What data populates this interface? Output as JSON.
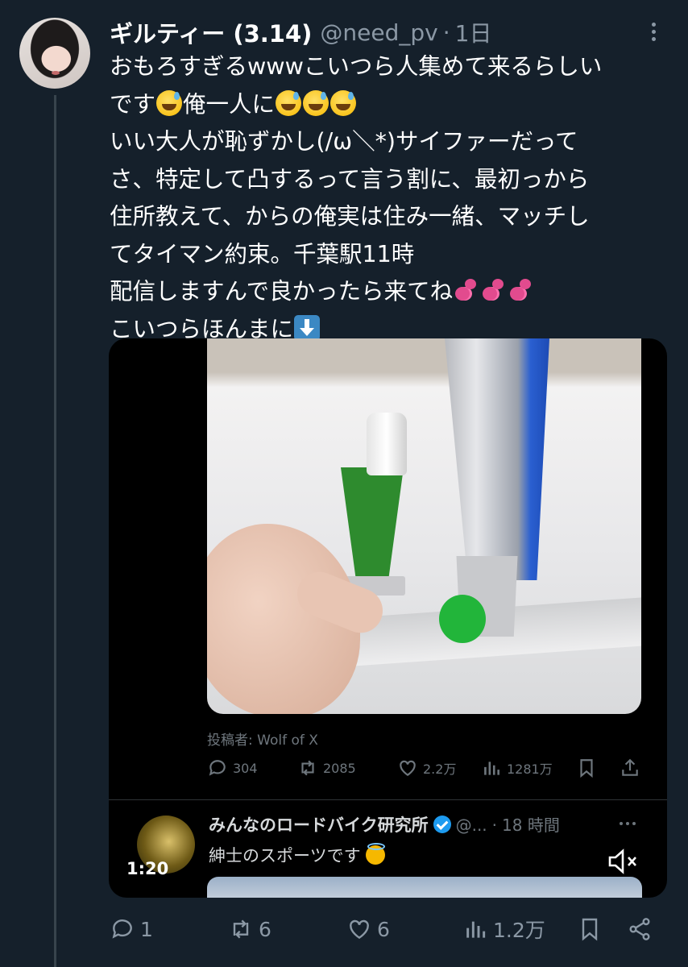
{
  "author": {
    "display_name": "ギルティー (3.14)",
    "handle": "@need_pv",
    "separator": "·",
    "time": "1日"
  },
  "tweet": {
    "lines": [
      "おもろすぎるwwwこいつら人集めて来るらしい",
      "です",
      "俺一人に",
      "いい大人が恥ずかし(/ω＼*)サイファーだって",
      "さ、特定して凸するって言う割に、最初っから",
      "住所教えて、からの俺実は住み一緒、マッチし",
      "てタイマン約束。千葉駅11時",
      "配信しますんで良かったら来てね",
      "こいつらほんまに"
    ],
    "emoji": [
      "grinning-sweat-emoji",
      "two-hearts-emoji",
      "down-arrow-emoji"
    ]
  },
  "embedded_video": {
    "poster_label": "投稿者: Wolf of X",
    "inner_stats": {
      "replies": "304",
      "reposts": "2085",
      "likes": "2.2万",
      "views": "1281万"
    },
    "quoted_account": {
      "name": "みんなのロードバイク研究所",
      "handle": "@...",
      "separator": "·",
      "time": "18 時間"
    },
    "quoted_text": "紳士のスポーツです",
    "timestamp": "1:20"
  },
  "actions": {
    "replies": "1",
    "reposts": "6",
    "likes": "6",
    "views": "1.2万"
  },
  "colors": {
    "background": "#15202b",
    "text": "#ffffff",
    "secondary": "#8b98a5",
    "thread_line": "#38444d",
    "verified": "#1d9bf0"
  }
}
